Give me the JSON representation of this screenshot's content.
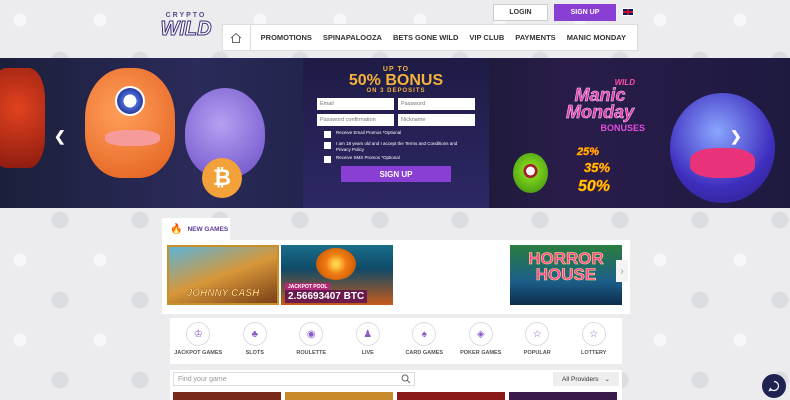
{
  "header": {
    "logo_top": "CRYPTO",
    "logo_main": "WILD",
    "login_label": "LOGIN",
    "signup_label": "SIGN UP",
    "language_icon": "uk-flag-icon"
  },
  "nav": {
    "items": [
      "PROMOTIONS",
      "SPINAPALOOZA",
      "BETS GONE WILD",
      "VIP CLUB",
      "PAYMENTS",
      "MANIC MONDAY"
    ]
  },
  "hero": {
    "promo_wild": "WILD",
    "promo_manic": "Manic Monday",
    "promo_bonuses": "BONUSES",
    "percents": [
      "25%",
      "35%",
      "50%"
    ],
    "coin_symbol": "₿"
  },
  "signup_card": {
    "up_to": "UP TO",
    "bonus": "50% BONUS",
    "deposits": "ON 3 DEPOSITS",
    "email_placeholder": "Email",
    "password_placeholder": "Password",
    "password_confirm_placeholder": "Password confirmation",
    "nickname_placeholder": "Nickname",
    "check_email": "Receive Email Promos *Optional",
    "check_age": "I am 18 years old and I accept the Terms and Conditions and Privacy Policy",
    "check_sms": "Receive SMS Promos *Optional",
    "submit_label": "SIGN UP"
  },
  "new_games": {
    "tab_label": "NEW GAMES",
    "games": [
      {
        "title": "JOHNNY CASH"
      },
      {
        "title": "JACKPOT POOL",
        "jackpot_value": "2.56693407 BTC"
      },
      {
        "title": "HORROR HOUSE"
      }
    ]
  },
  "categories": [
    "JACKPOT GAMES",
    "SLOTS",
    "ROULETTE",
    "LIVE",
    "CARD GAMES",
    "POKER GAMES",
    "POPULAR",
    "LOTTERY"
  ],
  "search": {
    "placeholder": "Find your game",
    "provider_label": "All Providers"
  },
  "colors": {
    "accent": "#8a3fd4",
    "bonus_gold": "#f4b13c"
  }
}
